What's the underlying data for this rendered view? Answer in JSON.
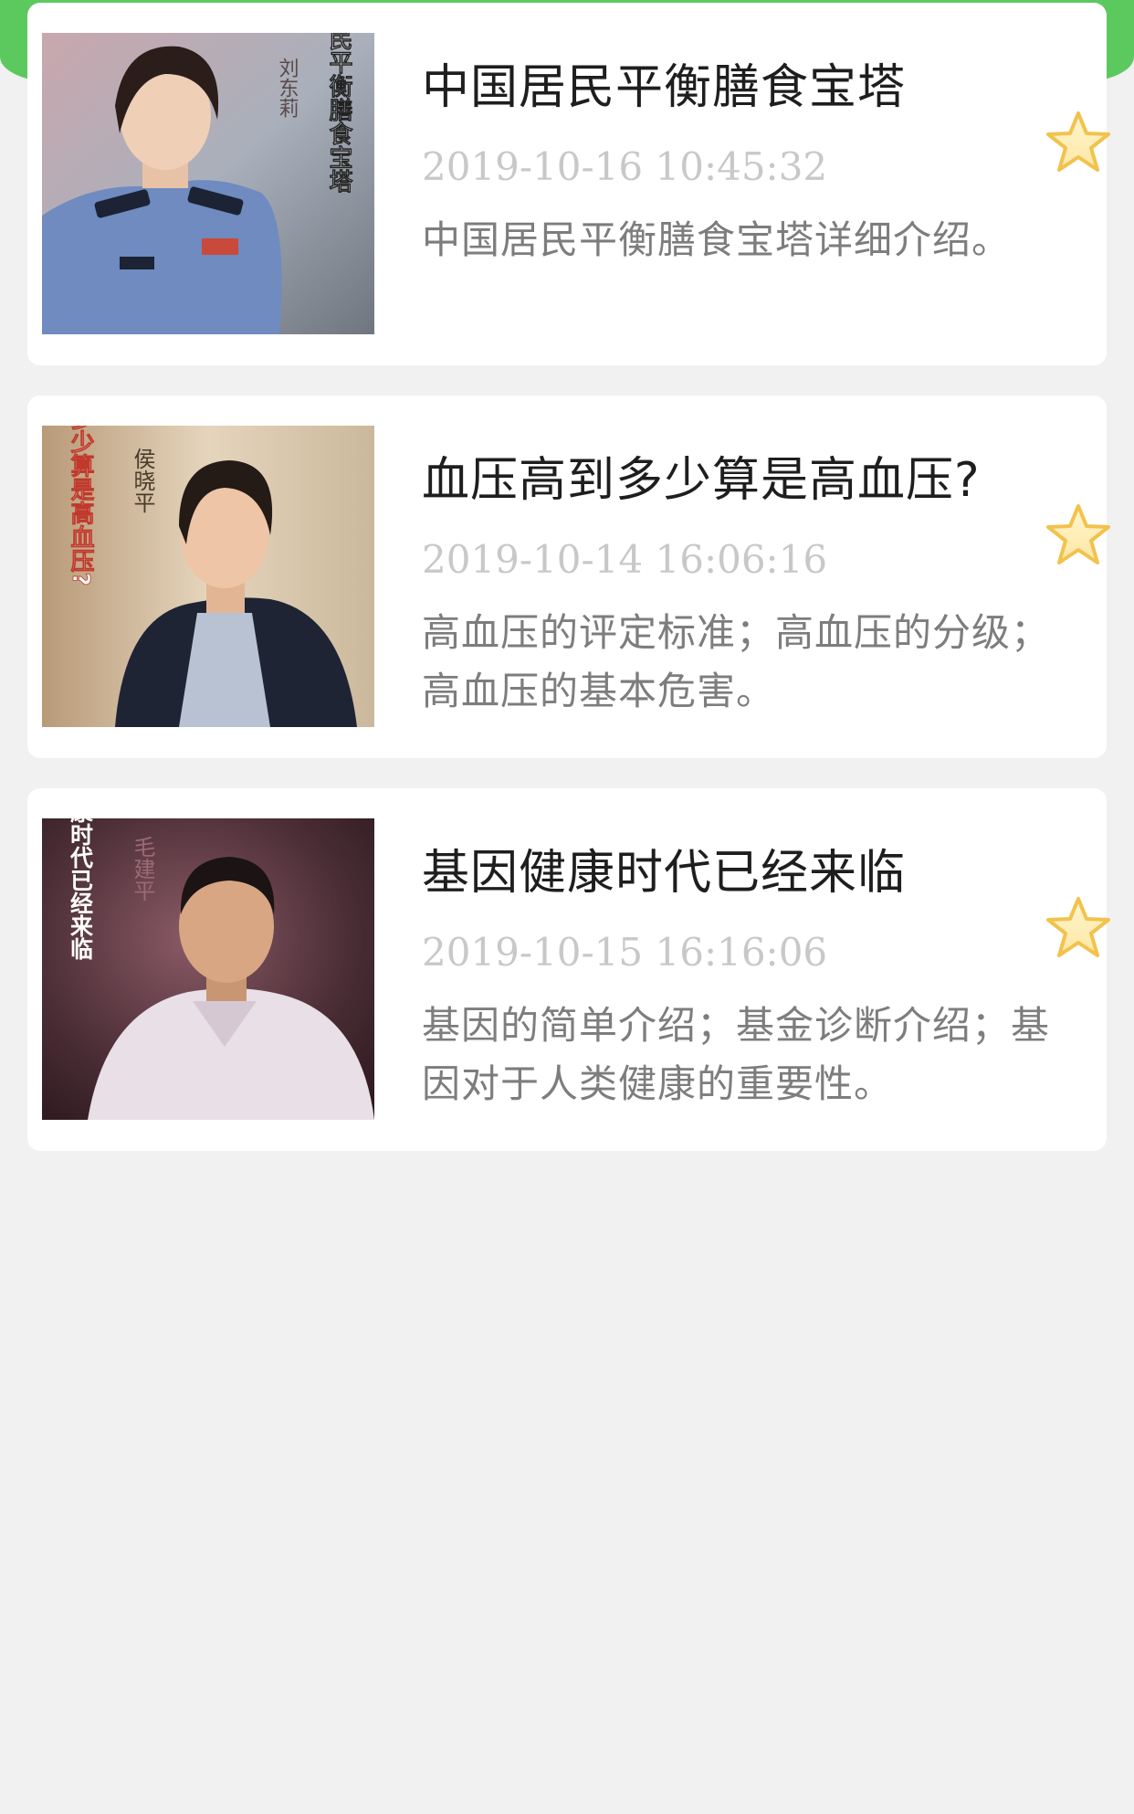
{
  "header": {
    "accent": "#5cc95f"
  },
  "articles": [
    {
      "title": "中国居民平衡膳食宝塔",
      "date": "2019-10-16 10:45:32",
      "description": "中国居民平衡膳食宝塔详细介绍。",
      "thumb": {
        "vertical_title": "中国居民平衡膳食宝塔",
        "author": "刘东莉",
        "bg": "#9ea8b6"
      },
      "favorite_icon": "star-icon"
    },
    {
      "title": "血压高到多少算是高血压?",
      "date": "2019-10-14 16:06:16",
      "description": "高血压的评定标准；高血压的分级；高血压的基本危害。",
      "thumb": {
        "vertical_title": "血压高到多少算是高血压?",
        "author": "侯晓平",
        "bg": "#c9b497"
      },
      "favorite_icon": "star-icon"
    },
    {
      "title": "基因健康时代已经来临",
      "date": "2019-10-15 16:16:06",
      "description": "基因的简单介绍；基金诊断介绍；基因对于人类健康的重要性。",
      "thumb": {
        "vertical_title": "基因健康时代已经来临",
        "author": "毛建平",
        "bg": "#4a2d35"
      },
      "favorite_icon": "star-icon"
    }
  ]
}
